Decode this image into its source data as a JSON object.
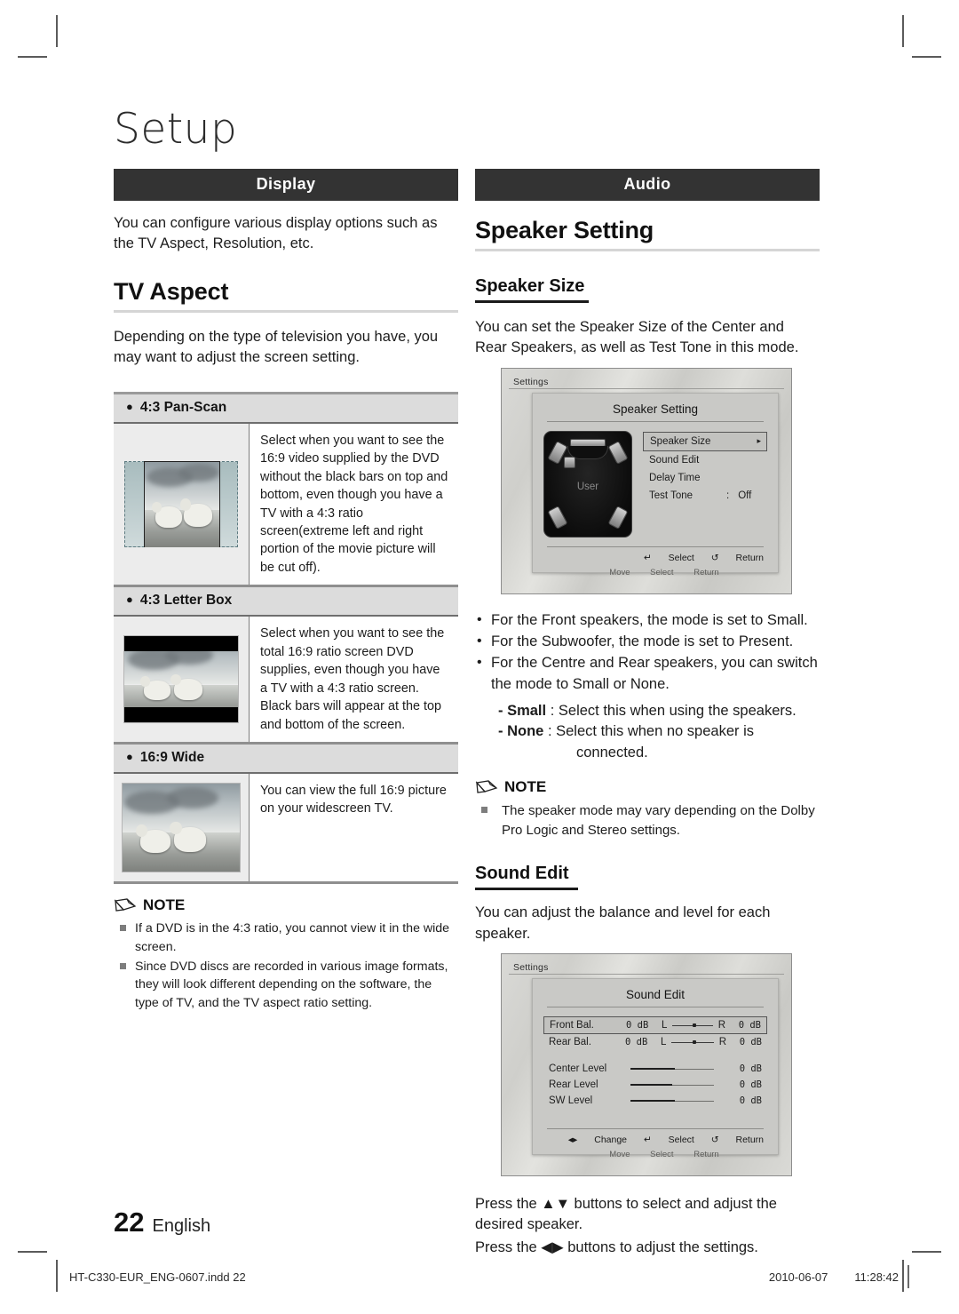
{
  "page": {
    "title": "Setup",
    "page_number": "22",
    "language": "English",
    "footer_file": "HT-C330-EUR_ENG-0607.indd   22",
    "footer_date": "2010-06-07",
    "footer_time": "11:28:42"
  },
  "left": {
    "section_bar": "Display",
    "intro": "You can configure various display options such as the TV Aspect, Resolution, etc.",
    "heading": "TV Aspect",
    "heading_text": "Depending on the type of television you have, you may want to adjust the screen setting.",
    "table": [
      {
        "label": "4:3 Pan-Scan",
        "image": "pan-scan-thumbnail",
        "description": "Select when you want to see the 16:9 video supplied by the DVD without the black bars on top and bottom, even though you have a TV with a 4:3 ratio screen(extreme left and right portion of the movie picture will be cut off)."
      },
      {
        "label": "4:3 Letter Box",
        "image": "letter-box-thumbnail",
        "description": "Select when you want to see the total 16:9 ratio screen DVD supplies, even though you have a TV with a 4:3 ratio screen. Black bars will appear at the top and bottom of the screen."
      },
      {
        "label": "16:9 Wide",
        "image": "wide-thumbnail",
        "description": "You can view the full 16:9 picture on your widescreen TV."
      }
    ],
    "note": {
      "title": "NOTE",
      "items": [
        "If a DVD is in the 4:3 ratio, you cannot view it in the wide screen.",
        "Since DVD discs are recorded in various image formats, they will look different depending on the software, the type of TV, and the TV aspect ratio setting."
      ]
    }
  },
  "right": {
    "section_bar": "Audio",
    "heading": "Speaker Setting",
    "sub_heading_1": "Speaker Size",
    "sub_text_1": "You can set the Speaker Size of the Center and Rear Speakers, as well as Test Tone in this mode.",
    "osd_speaker": {
      "settings_label": "Settings",
      "dialog_title": "Speaker Setting",
      "diagram_label": "User",
      "menu": [
        {
          "label": "Speaker Size",
          "value": "",
          "selected": true,
          "arrow": "▸"
        },
        {
          "label": "Sound Edit",
          "value": "",
          "selected": false,
          "arrow": ""
        },
        {
          "label": "Delay Time",
          "value": "",
          "selected": false,
          "arrow": ""
        },
        {
          "label": "Test Tone",
          "colon": ":",
          "value": "Off",
          "selected": false,
          "arrow": ""
        }
      ],
      "footer_select": "Select",
      "footer_return": "Return",
      "ghost_move": "Move",
      "ghost_select": "Select",
      "ghost_return": "Return"
    },
    "bullets": [
      "For the Front speakers, the mode is set to Small.",
      "For the Subwoofer, the mode is set to Present.",
      "For the Centre and Rear speakers, you can switch the mode to Small or None."
    ],
    "definitions": [
      {
        "term": "- Small",
        "colon": ":",
        "text": "Select this when using the speakers."
      },
      {
        "term": "- None",
        "colon": ":",
        "text": "Select this when no speaker is",
        "text2": "connected."
      }
    ],
    "note": {
      "title": "NOTE",
      "items": [
        "The speaker mode may vary depending on the Dolby Pro Logic and Stereo settings."
      ]
    },
    "sub_heading_2": "Sound Edit",
    "sub_text_2": "You can adjust the balance and level for each speaker.",
    "osd_sound": {
      "settings_label": "Settings",
      "dialog_title": "Sound Edit",
      "balance_rows": [
        {
          "name": "Front  Bal.",
          "left_db": "0 dB",
          "left_tag": "L",
          "right_tag": "R",
          "right_db": "0 dB",
          "knob_pct": 50,
          "selected": true
        },
        {
          "name": "Rear  Bal.",
          "left_db": "0 dB",
          "left_tag": "L",
          "right_tag": "R",
          "right_db": "0 dB",
          "knob_pct": 50,
          "selected": false
        }
      ],
      "level_rows": [
        {
          "name": "Center  Level",
          "value": "0 dB",
          "fill_pct": 53
        },
        {
          "name": "Rear  Level",
          "value": "0 dB",
          "fill_pct": 50
        },
        {
          "name": "SW  Level",
          "value": "0 dB",
          "fill_pct": 53
        }
      ],
      "footer_change": "Change",
      "footer_select": "Select",
      "footer_return": "Return",
      "ghost_move": "Move",
      "ghost_select": "Select",
      "ghost_return": "Return"
    },
    "closing_1": "Press the ▲▼ buttons to select and adjust the desired speaker.",
    "closing_2": "Press the ◀▶ buttons to adjust the settings."
  }
}
